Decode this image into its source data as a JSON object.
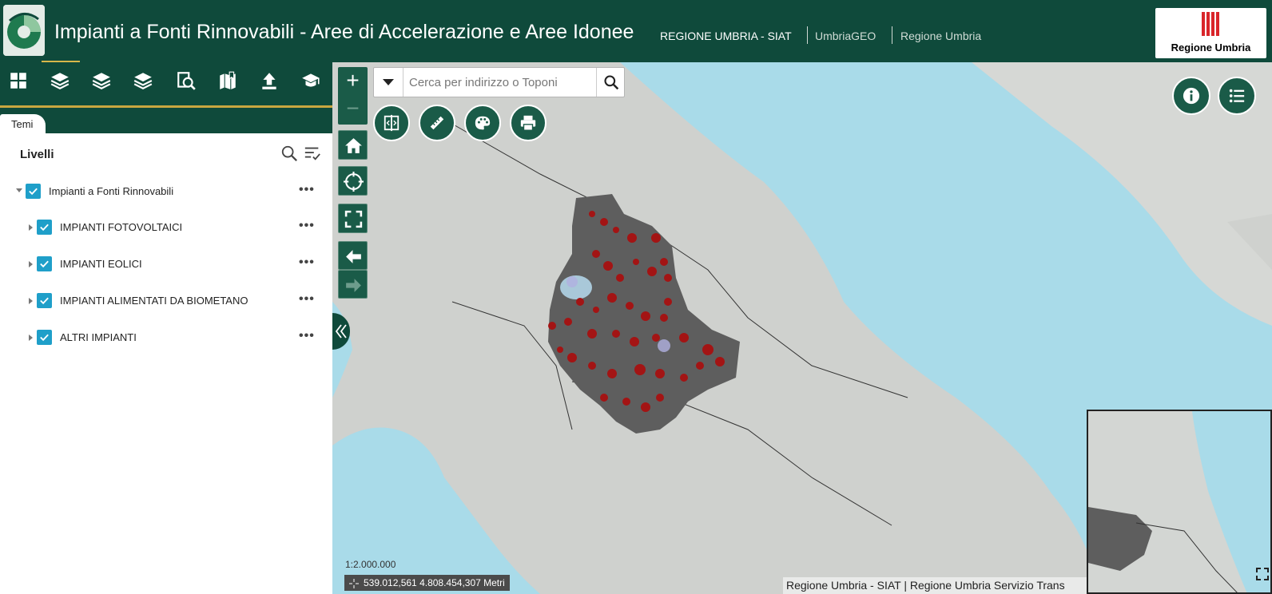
{
  "header": {
    "title": "Impianti a Fonti Rinnovabili - Aree di Accelerazione e Aree Idonee",
    "links": [
      "REGIONE UMBRIA - SIAT",
      "UmbriaGEO",
      "Regione Umbria"
    ],
    "brand_text": "Regione Umbria"
  },
  "toolbar": {
    "icons": [
      "widgets-grid-icon",
      "layers-icon",
      "basemap-layers-icon",
      "layers-alt-icon",
      "query-icon",
      "bookmark-icon",
      "upload-icon",
      "print-hat-icon"
    ]
  },
  "panel": {
    "tab_label": "Temi",
    "title": "Livelli",
    "layers": [
      {
        "label": "Impianti a Fonti Rinnovabili",
        "checked": true,
        "expanded": true
      },
      {
        "label": "IMPIANTI FOTOVOLTAICI",
        "checked": true,
        "expanded": false
      },
      {
        "label": "IMPIANTI EOLICI",
        "checked": true,
        "expanded": false
      },
      {
        "label": "IMPIANTI ALIMENTATI DA BIOMETANO",
        "checked": true,
        "expanded": false
      },
      {
        "label": "ALTRI IMPIANTI",
        "checked": true,
        "expanded": false
      }
    ],
    "more_glyph": "•••"
  },
  "map": {
    "search_placeholder": "Cerca per indirizzo o Toponi",
    "zoom_in": "+",
    "zoom_out": "−",
    "scale": "1:2.000.000",
    "coordinates": "539.012,561 4.808.454,307 Metri",
    "attribution": "Regione Umbria - SIAT | Regione Umbria Servizio Trans",
    "colors": {
      "accent": "#0f4a3b",
      "gold": "#c9a640",
      "sea": "#a9dbe9",
      "marker": "#a31414"
    }
  }
}
